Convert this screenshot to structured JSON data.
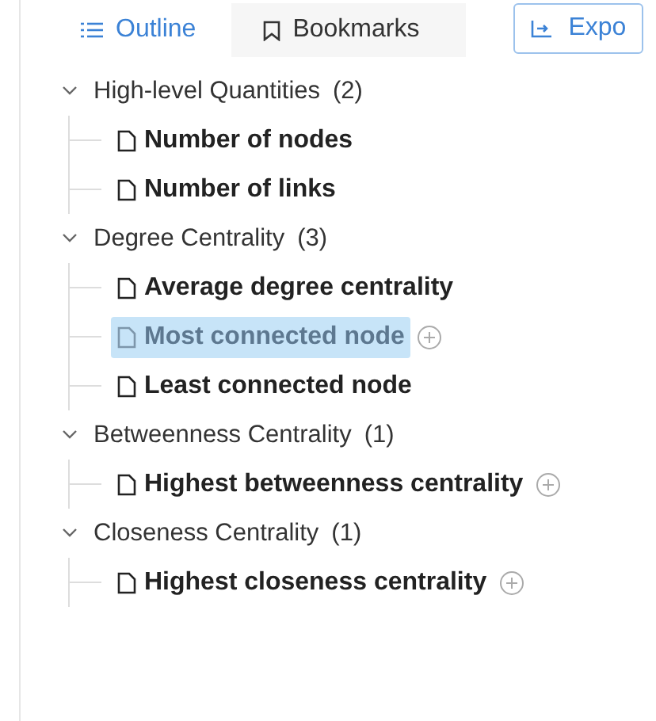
{
  "tabs": [
    {
      "label": "Outline",
      "selected": true
    },
    {
      "label": "Bookmarks",
      "selected": false
    }
  ],
  "export_button": {
    "label": "Expo"
  },
  "groups": [
    {
      "title": "High-level Quantities",
      "count": "(2)",
      "expanded": true,
      "children": [
        {
          "label": "Number of nodes",
          "selected": false,
          "add": false
        },
        {
          "label": "Number of links",
          "selected": false,
          "add": false
        }
      ]
    },
    {
      "title": "Degree Centrality",
      "count": "(3)",
      "expanded": true,
      "children": [
        {
          "label": "Average degree centrality",
          "selected": false,
          "add": false
        },
        {
          "label": "Most connected node",
          "selected": true,
          "add": true
        },
        {
          "label": "Least connected node",
          "selected": false,
          "add": false
        }
      ]
    },
    {
      "title": "Betweenness Centrality",
      "count": "(1)",
      "expanded": true,
      "children": [
        {
          "label": "Highest betweenness centrality",
          "selected": false,
          "add": true
        }
      ]
    },
    {
      "title": "Closeness Centrality",
      "count": "(1)",
      "expanded": true,
      "children": [
        {
          "label": "Highest closeness centrality",
          "selected": false,
          "add": true
        }
      ]
    }
  ]
}
